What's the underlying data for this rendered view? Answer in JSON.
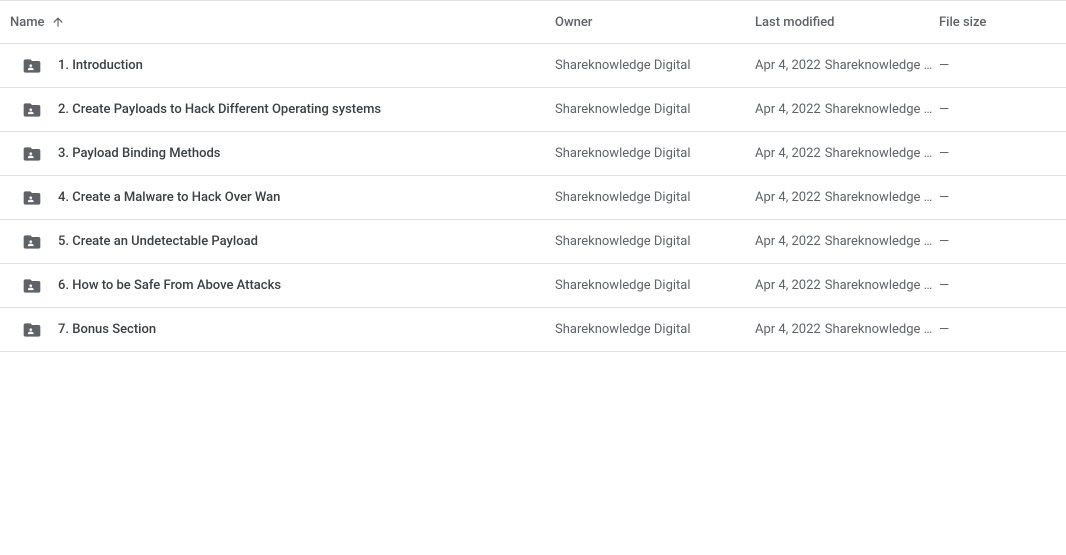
{
  "columns": {
    "name": "Name",
    "owner": "Owner",
    "modified": "Last modified",
    "size": "File size"
  },
  "sort": {
    "column": "name",
    "direction": "asc"
  },
  "rows": [
    {
      "name": "1. Introduction",
      "owner": "Shareknowledge Digital",
      "modified_date": "Apr 4, 2022",
      "modified_by": "Shareknowledge D…",
      "size": "—"
    },
    {
      "name": "2. Create Payloads to Hack Different Operating systems",
      "owner": "Shareknowledge Digital",
      "modified_date": "Apr 4, 2022",
      "modified_by": "Shareknowledge D…",
      "size": "—"
    },
    {
      "name": "3. Payload Binding Methods",
      "owner": "Shareknowledge Digital",
      "modified_date": "Apr 4, 2022",
      "modified_by": "Shareknowledge D…",
      "size": "—"
    },
    {
      "name": "4. Create a Malware to Hack Over Wan",
      "owner": "Shareknowledge Digital",
      "modified_date": "Apr 4, 2022",
      "modified_by": "Shareknowledge D…",
      "size": "—"
    },
    {
      "name": "5. Create an Undetectable Payload",
      "owner": "Shareknowledge Digital",
      "modified_date": "Apr 4, 2022",
      "modified_by": "Shareknowledge D…",
      "size": "—"
    },
    {
      "name": "6. How to be Safe From Above Attacks",
      "owner": "Shareknowledge Digital",
      "modified_date": "Apr 4, 2022",
      "modified_by": "Shareknowledge D…",
      "size": "—"
    },
    {
      "name": "7. Bonus Section",
      "owner": "Shareknowledge Digital",
      "modified_date": "Apr 4, 2022",
      "modified_by": "Shareknowledge D…",
      "size": "—"
    }
  ]
}
